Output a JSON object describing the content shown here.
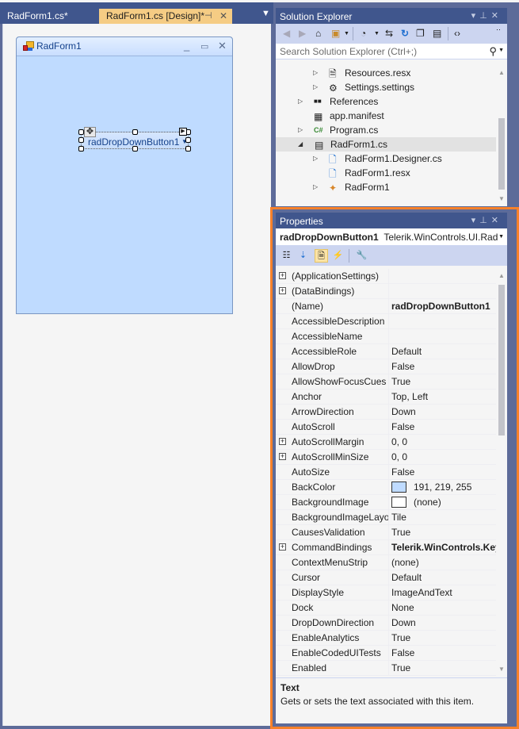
{
  "document_tabs": [
    {
      "label": "RadForm1.cs*",
      "active": false
    },
    {
      "label": "RadForm1.cs [Design]*",
      "active": true
    }
  ],
  "form": {
    "title": "RadForm1",
    "back_color": "#bfdbff",
    "dropdown_button": {
      "text": "radDropDownButton1"
    }
  },
  "solution_explorer": {
    "title": "Solution Explorer",
    "search_placeholder": "Search Solution Explorer (Ctrl+;)",
    "tree": [
      {
        "label": "Resources.resx",
        "icon": "resx-icon",
        "expander": "collapsed"
      },
      {
        "label": "Settings.settings",
        "icon": "gear-icon",
        "expander": "collapsed"
      },
      {
        "label": "References",
        "icon": "references-icon",
        "expander": "collapsed"
      },
      {
        "label": "app.manifest",
        "icon": "manifest-icon",
        "expander": "none"
      },
      {
        "label": "Program.cs",
        "icon": "csharp-icon",
        "expander": "collapsed"
      },
      {
        "label": "RadForm1.cs",
        "icon": "form-icon",
        "expander": "expanded",
        "selected": true
      },
      {
        "label": "RadForm1.Designer.cs",
        "icon": "code-file-icon",
        "expander": "collapsed"
      },
      {
        "label": "RadForm1.resx",
        "icon": "code-file-icon",
        "expander": "none"
      },
      {
        "label": "RadForm1",
        "icon": "class-icon",
        "expander": "collapsed"
      }
    ]
  },
  "properties": {
    "title": "Properties",
    "object_name": "radDropDownButton1",
    "object_type": "Telerik.WinControls.UI.Rad",
    "rows": [
      {
        "name": "(ApplicationSettings)",
        "value": "",
        "expandable": true
      },
      {
        "name": "(DataBindings)",
        "value": "",
        "expandable": true
      },
      {
        "name": "(Name)",
        "value": "radDropDownButton1",
        "bold": true
      },
      {
        "name": "AccessibleDescription",
        "value": ""
      },
      {
        "name": "AccessibleName",
        "value": ""
      },
      {
        "name": "AccessibleRole",
        "value": "Default"
      },
      {
        "name": "AllowDrop",
        "value": "False"
      },
      {
        "name": "AllowShowFocusCues",
        "value": "True"
      },
      {
        "name": "Anchor",
        "value": "Top, Left"
      },
      {
        "name": "ArrowDirection",
        "value": "Down"
      },
      {
        "name": "AutoScroll",
        "value": "False"
      },
      {
        "name": "AutoScrollMargin",
        "value": "0, 0",
        "expandable": true
      },
      {
        "name": "AutoScrollMinSize",
        "value": "0, 0",
        "expandable": true
      },
      {
        "name": "AutoSize",
        "value": "False"
      },
      {
        "name": "BackColor",
        "value": "191, 219, 255",
        "swatch": "#bfdbff"
      },
      {
        "name": "BackgroundImage",
        "value": "(none)",
        "swatch": "#ffffff"
      },
      {
        "name": "BackgroundImageLayo",
        "value": "Tile"
      },
      {
        "name": "CausesValidation",
        "value": "True"
      },
      {
        "name": "CommandBindings",
        "value": "Telerik.WinControls.Key",
        "bold": true,
        "expandable": true
      },
      {
        "name": "ContextMenuStrip",
        "value": "(none)"
      },
      {
        "name": "Cursor",
        "value": "Default"
      },
      {
        "name": "DisplayStyle",
        "value": "ImageAndText"
      },
      {
        "name": "Dock",
        "value": "None"
      },
      {
        "name": "DropDownDirection",
        "value": "Down"
      },
      {
        "name": "EnableAnalytics",
        "value": "True"
      },
      {
        "name": "EnableCodedUITests",
        "value": "False"
      },
      {
        "name": "Enabled",
        "value": "True"
      }
    ],
    "description": {
      "title": "Text",
      "text": "Gets or sets the text associated with this item."
    }
  },
  "colors": {
    "accent_highlight": "#f7812a",
    "panel_title": "#40568d",
    "active_tab": "#f5cc84"
  }
}
